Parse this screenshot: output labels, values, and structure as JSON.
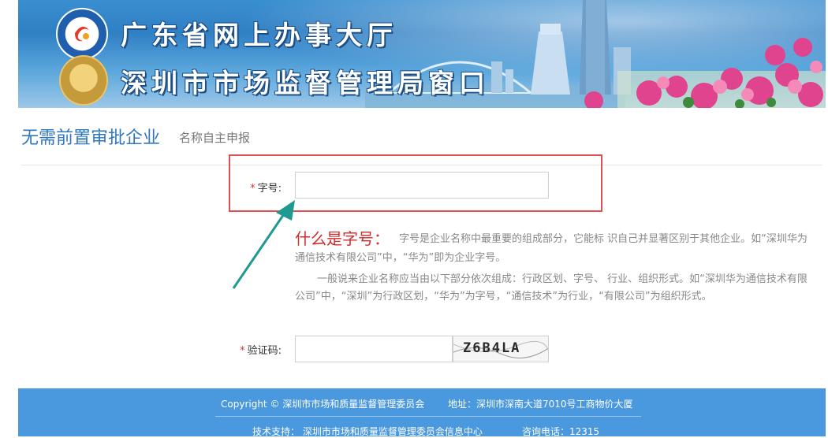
{
  "banner": {
    "title_line1": "广东省网上办事大厅",
    "title_line2": "深圳市市场监督管理局窗口"
  },
  "page": {
    "title": "无需前置审批企业",
    "subtitle": "名称自主申报"
  },
  "form": {
    "name_field": {
      "required_mark": "*",
      "label": "字号:",
      "value": ""
    },
    "captcha_field": {
      "required_mark": "*",
      "label": "验证码:",
      "value": ""
    },
    "captcha_image_text": "Z6B4LA"
  },
  "help": {
    "title": "什么是字号：",
    "paragraph1": "字号是企业名称中最重要的组成部分，它能标 识自己并显著区别于其他企业。如“深圳华为通信技术有限公司”中，“华为”即为企业字号。",
    "paragraph2": "一般说来企业名称应当由以下部分依次组成：行政区划、字号、 行业、组织形式。如“深圳华为通信技术有限公司”中，“深圳”为行政区划，“华为”为字号，“通信技术”为行业，“有限公司”为组织形式。"
  },
  "footer": {
    "copyright": "Copyright © 深圳市市场和质量监督管理委员会",
    "address": "地址：深圳市深南大道7010号工商物价大厦",
    "tech_support": "技术支持： 深圳市市场和质量监督管理委员会信息中心",
    "hotline": "咨询电话：12315"
  },
  "colors": {
    "accent": "#2f77bf",
    "footer_bg": "#4a98de",
    "highlight": "#e05050",
    "help_title": "#d42a2a",
    "arrow": "#1f9a90"
  },
  "icons": [
    "guangdong-service-logo-icon",
    "market-supervision-emblem-icon",
    "arrow-annotation-icon"
  ]
}
